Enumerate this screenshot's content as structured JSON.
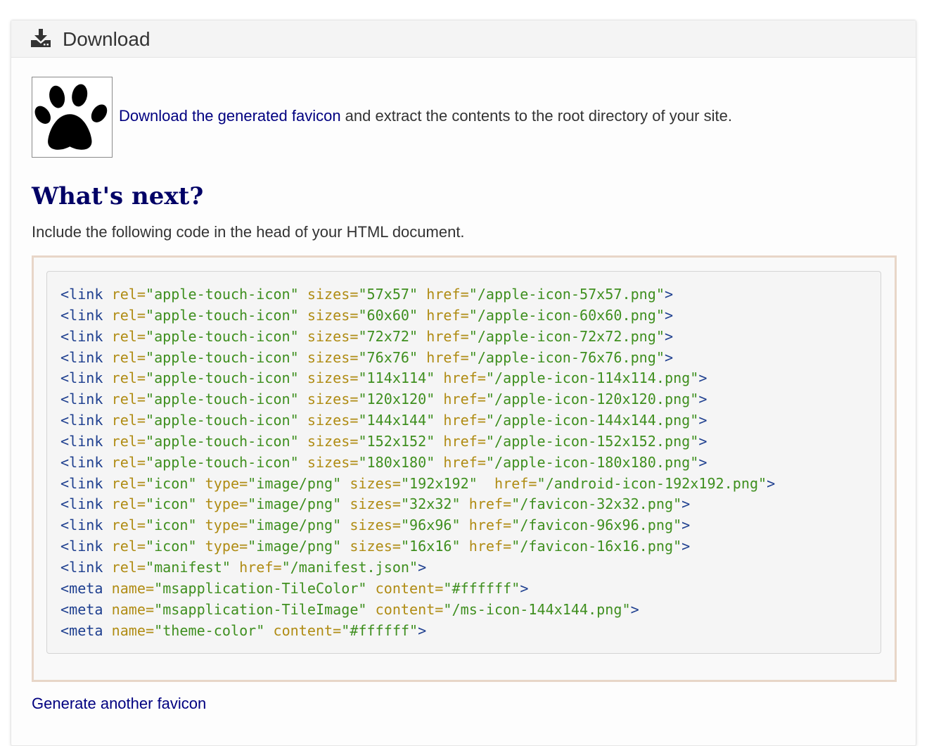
{
  "panel": {
    "title": "Download",
    "icon": "download-icon"
  },
  "download": {
    "favicon_icon": "paw-print-icon",
    "link_text": "Download the generated favicon",
    "rest_text": " and extract the contents to the root directory of your site."
  },
  "whats_next": {
    "heading": "What's next?",
    "instruction": "Include the following code in the head of your HTML document."
  },
  "code": {
    "lines": [
      [
        [
          "<link ",
          "tag"
        ],
        [
          "rel=",
          "attr"
        ],
        [
          "\"apple-touch-icon\"",
          "val"
        ],
        [
          " sizes=",
          "attr"
        ],
        [
          "\"57x57\"",
          "val"
        ],
        [
          " href=",
          "attr"
        ],
        [
          "\"/apple-icon-57x57.png\"",
          "val"
        ],
        [
          ">",
          "tag"
        ]
      ],
      [
        [
          "<link ",
          "tag"
        ],
        [
          "rel=",
          "attr"
        ],
        [
          "\"apple-touch-icon\"",
          "val"
        ],
        [
          " sizes=",
          "attr"
        ],
        [
          "\"60x60\"",
          "val"
        ],
        [
          " href=",
          "attr"
        ],
        [
          "\"/apple-icon-60x60.png\"",
          "val"
        ],
        [
          ">",
          "tag"
        ]
      ],
      [
        [
          "<link ",
          "tag"
        ],
        [
          "rel=",
          "attr"
        ],
        [
          "\"apple-touch-icon\"",
          "val"
        ],
        [
          " sizes=",
          "attr"
        ],
        [
          "\"72x72\"",
          "val"
        ],
        [
          " href=",
          "attr"
        ],
        [
          "\"/apple-icon-72x72.png\"",
          "val"
        ],
        [
          ">",
          "tag"
        ]
      ],
      [
        [
          "<link ",
          "tag"
        ],
        [
          "rel=",
          "attr"
        ],
        [
          "\"apple-touch-icon\"",
          "val"
        ],
        [
          " sizes=",
          "attr"
        ],
        [
          "\"76x76\"",
          "val"
        ],
        [
          " href=",
          "attr"
        ],
        [
          "\"/apple-icon-76x76.png\"",
          "val"
        ],
        [
          ">",
          "tag"
        ]
      ],
      [
        [
          "<link ",
          "tag"
        ],
        [
          "rel=",
          "attr"
        ],
        [
          "\"apple-touch-icon\"",
          "val"
        ],
        [
          " sizes=",
          "attr"
        ],
        [
          "\"114x114\"",
          "val"
        ],
        [
          " href=",
          "attr"
        ],
        [
          "\"/apple-icon-114x114.png\"",
          "val"
        ],
        [
          ">",
          "tag"
        ]
      ],
      [
        [
          "<link ",
          "tag"
        ],
        [
          "rel=",
          "attr"
        ],
        [
          "\"apple-touch-icon\"",
          "val"
        ],
        [
          " sizes=",
          "attr"
        ],
        [
          "\"120x120\"",
          "val"
        ],
        [
          " href=",
          "attr"
        ],
        [
          "\"/apple-icon-120x120.png\"",
          "val"
        ],
        [
          ">",
          "tag"
        ]
      ],
      [
        [
          "<link ",
          "tag"
        ],
        [
          "rel=",
          "attr"
        ],
        [
          "\"apple-touch-icon\"",
          "val"
        ],
        [
          " sizes=",
          "attr"
        ],
        [
          "\"144x144\"",
          "val"
        ],
        [
          " href=",
          "attr"
        ],
        [
          "\"/apple-icon-144x144.png\"",
          "val"
        ],
        [
          ">",
          "tag"
        ]
      ],
      [
        [
          "<link ",
          "tag"
        ],
        [
          "rel=",
          "attr"
        ],
        [
          "\"apple-touch-icon\"",
          "val"
        ],
        [
          " sizes=",
          "attr"
        ],
        [
          "\"152x152\"",
          "val"
        ],
        [
          " href=",
          "attr"
        ],
        [
          "\"/apple-icon-152x152.png\"",
          "val"
        ],
        [
          ">",
          "tag"
        ]
      ],
      [
        [
          "<link ",
          "tag"
        ],
        [
          "rel=",
          "attr"
        ],
        [
          "\"apple-touch-icon\"",
          "val"
        ],
        [
          " sizes=",
          "attr"
        ],
        [
          "\"180x180\"",
          "val"
        ],
        [
          " href=",
          "attr"
        ],
        [
          "\"/apple-icon-180x180.png\"",
          "val"
        ],
        [
          ">",
          "tag"
        ]
      ],
      [
        [
          "<link ",
          "tag"
        ],
        [
          "rel=",
          "attr"
        ],
        [
          "\"icon\"",
          "val"
        ],
        [
          " type=",
          "attr"
        ],
        [
          "\"image/png\"",
          "val"
        ],
        [
          " sizes=",
          "attr"
        ],
        [
          "\"192x192\"",
          "val"
        ],
        [
          "  href=",
          "attr"
        ],
        [
          "\"/android-icon-192x192.png\"",
          "val"
        ],
        [
          ">",
          "tag"
        ]
      ],
      [
        [
          "<link ",
          "tag"
        ],
        [
          "rel=",
          "attr"
        ],
        [
          "\"icon\"",
          "val"
        ],
        [
          " type=",
          "attr"
        ],
        [
          "\"image/png\"",
          "val"
        ],
        [
          " sizes=",
          "attr"
        ],
        [
          "\"32x32\"",
          "val"
        ],
        [
          " href=",
          "attr"
        ],
        [
          "\"/favicon-32x32.png\"",
          "val"
        ],
        [
          ">",
          "tag"
        ]
      ],
      [
        [
          "<link ",
          "tag"
        ],
        [
          "rel=",
          "attr"
        ],
        [
          "\"icon\"",
          "val"
        ],
        [
          " type=",
          "attr"
        ],
        [
          "\"image/png\"",
          "val"
        ],
        [
          " sizes=",
          "attr"
        ],
        [
          "\"96x96\"",
          "val"
        ],
        [
          " href=",
          "attr"
        ],
        [
          "\"/favicon-96x96.png\"",
          "val"
        ],
        [
          ">",
          "tag"
        ]
      ],
      [
        [
          "<link ",
          "tag"
        ],
        [
          "rel=",
          "attr"
        ],
        [
          "\"icon\"",
          "val"
        ],
        [
          " type=",
          "attr"
        ],
        [
          "\"image/png\"",
          "val"
        ],
        [
          " sizes=",
          "attr"
        ],
        [
          "\"16x16\"",
          "val"
        ],
        [
          " href=",
          "attr"
        ],
        [
          "\"/favicon-16x16.png\"",
          "val"
        ],
        [
          ">",
          "tag"
        ]
      ],
      [
        [
          "<link ",
          "tag"
        ],
        [
          "rel=",
          "attr"
        ],
        [
          "\"manifest\"",
          "val"
        ],
        [
          " href=",
          "attr"
        ],
        [
          "\"/manifest.json\"",
          "val"
        ],
        [
          ">",
          "tag"
        ]
      ],
      [
        [
          "<meta ",
          "tag"
        ],
        [
          "name=",
          "attr"
        ],
        [
          "\"msapplication-TileColor\"",
          "val"
        ],
        [
          " content=",
          "attr"
        ],
        [
          "\"#ffffff\"",
          "val"
        ],
        [
          ">",
          "tag"
        ]
      ],
      [
        [
          "<meta ",
          "tag"
        ],
        [
          "name=",
          "attr"
        ],
        [
          "\"msapplication-TileImage\"",
          "val"
        ],
        [
          " content=",
          "attr"
        ],
        [
          "\"/ms-icon-144x144.png\"",
          "val"
        ],
        [
          ">",
          "tag"
        ]
      ],
      [
        [
          "<meta ",
          "tag"
        ],
        [
          "name=",
          "attr"
        ],
        [
          "\"theme-color\"",
          "val"
        ],
        [
          " content=",
          "attr"
        ],
        [
          "\"#ffffff\"",
          "val"
        ],
        [
          ">",
          "tag"
        ]
      ]
    ]
  },
  "footer": {
    "generate_link": "Generate another favicon"
  },
  "colors": {
    "link": "#000080",
    "heading": "#000066",
    "code_tag": "#1e3f8f",
    "code_attr": "#b08c14",
    "code_value": "#3f8f1f",
    "code_border": "#e8d6c8"
  }
}
